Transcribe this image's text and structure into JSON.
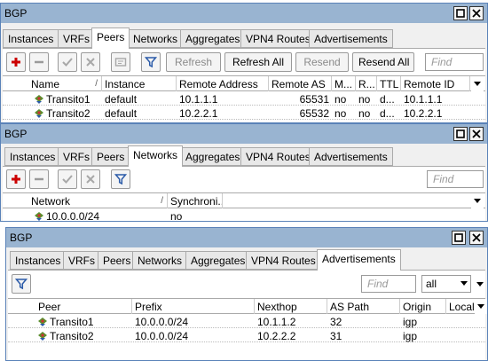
{
  "windows": {
    "peers": {
      "title": "BGP",
      "tabs": [
        "Instances",
        "VRFs",
        "Peers",
        "Networks",
        "Aggregates",
        "VPN4 Routes",
        "Advertisements"
      ],
      "toolbar": {
        "refresh": "Refresh",
        "refresh_all": "Refresh All",
        "resend": "Resend",
        "resend_all": "Resend All",
        "find_placeholder": "Find"
      },
      "columns": [
        "Name",
        "Instance",
        "Remote Address",
        "Remote AS",
        "M...",
        "R...",
        "TTL",
        "Remote ID"
      ],
      "rows": [
        [
          "Transito1",
          "default",
          "10.1.1.1",
          "65531",
          "no",
          "no",
          "d...",
          "10.1.1.1"
        ],
        [
          "Transito2",
          "default",
          "10.2.2.1",
          "65532",
          "no",
          "no",
          "d...",
          "10.2.2.1"
        ]
      ]
    },
    "networks": {
      "title": "BGP",
      "tabs": [
        "Instances",
        "VRFs",
        "Peers",
        "Networks",
        "Aggregates",
        "VPN4 Routes",
        "Advertisements"
      ],
      "toolbar": {
        "find_placeholder": "Find"
      },
      "columns": [
        "Network",
        "Synchroni..."
      ],
      "rows": [
        [
          "10.0.0.0/24",
          "no"
        ]
      ]
    },
    "advertisements": {
      "title": "BGP",
      "tabs": [
        "Instances",
        "VRFs",
        "Peers",
        "Networks",
        "Aggregates",
        "VPN4 Routes",
        "Advertisements"
      ],
      "toolbar": {
        "find_placeholder": "Find",
        "filter_value": "all"
      },
      "columns": [
        "Peer",
        "Prefix",
        "Nexthop",
        "AS Path",
        "Origin",
        "Local"
      ],
      "rows": [
        [
          "Transito1",
          "10.0.0.0/24",
          "10.1.1.2",
          "32",
          "igp",
          ""
        ],
        [
          "Transito2",
          "10.0.0.0/24",
          "10.2.2.2",
          "31",
          "igp",
          ""
        ]
      ]
    }
  },
  "colors": {
    "titlebar": "#99b4d1",
    "add": "#cc0000",
    "filter": "#2a5aa8"
  }
}
